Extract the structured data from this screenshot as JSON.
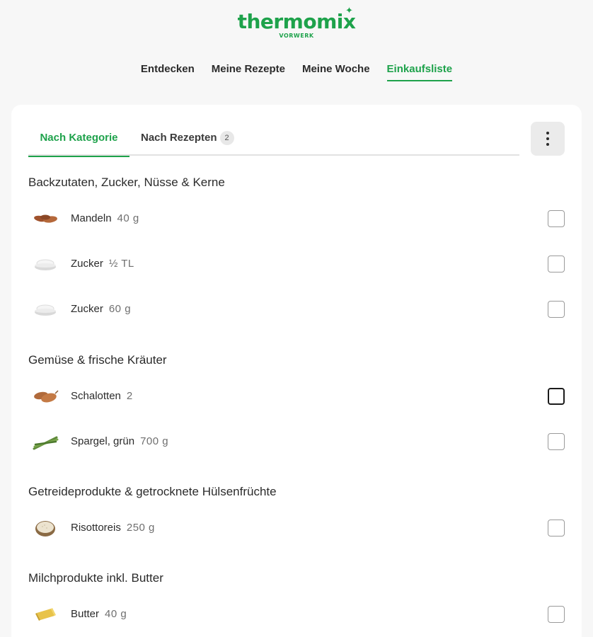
{
  "logo": {
    "wordmark": "thermomix",
    "sub": "VORWERK",
    "star": "✦"
  },
  "nav": {
    "items": [
      {
        "label": "Entdecken"
      },
      {
        "label": "Meine Rezepte"
      },
      {
        "label": "Meine Woche"
      },
      {
        "label": "Einkaufsliste",
        "active": true
      }
    ]
  },
  "tabs": {
    "by_category": "Nach Kategorie",
    "by_recipe": "Nach Rezepten",
    "recipe_count": "2"
  },
  "menu_icon": "more-vertical-icon",
  "categories": [
    {
      "title": "Backzutaten, Zucker, Nüsse & Kerne",
      "items": [
        {
          "name": "Mandeln",
          "qty": "40 g",
          "icon": "almonds"
        },
        {
          "name": "Zucker",
          "qty": "½ TL",
          "icon": "sugar"
        },
        {
          "name": "Zucker",
          "qty": "60 g",
          "icon": "sugar"
        }
      ]
    },
    {
      "title": "Gemüse & frische Kräuter",
      "items": [
        {
          "name": "Schalotten",
          "qty": "2",
          "icon": "shallots"
        },
        {
          "name": "Spargel, grün",
          "qty": "700 g",
          "icon": "asparagus"
        }
      ]
    },
    {
      "title": "Getreideprodukte & getrocknete Hülsenfrüchte",
      "items": [
        {
          "name": "Risottoreis",
          "qty": "250 g",
          "icon": "rice"
        }
      ]
    },
    {
      "title": "Milchprodukte inkl. Butter",
      "items": [
        {
          "name": "Butter",
          "qty": "40 g",
          "icon": "butter"
        }
      ]
    }
  ],
  "colors": {
    "brand": "#1ea24b",
    "background": "#f7f7f7",
    "card": "#ffffff"
  }
}
